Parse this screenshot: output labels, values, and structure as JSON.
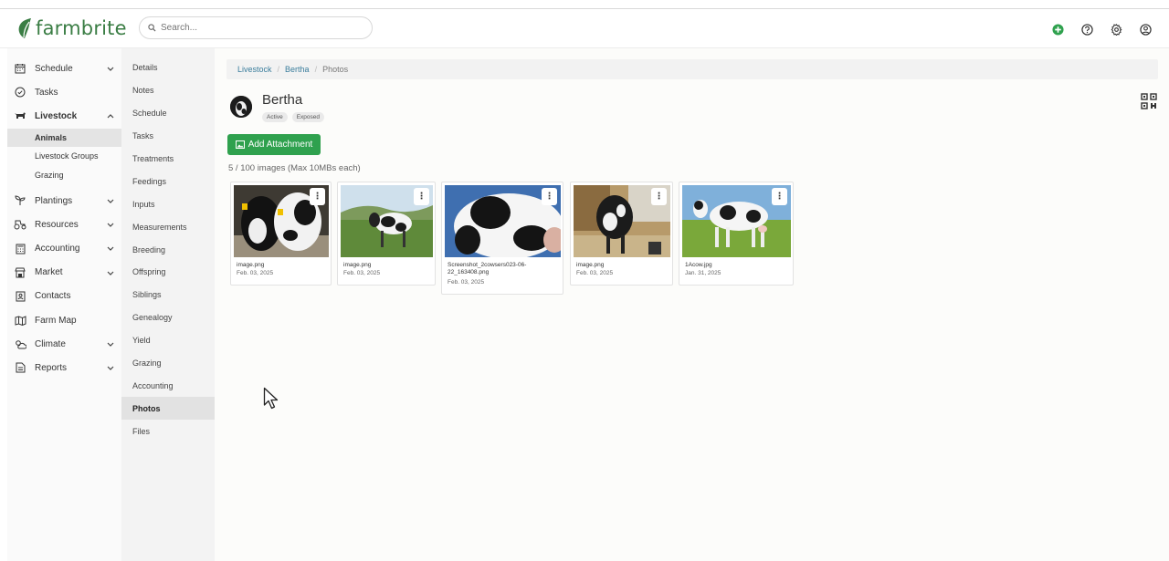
{
  "app": {
    "brand": "farmbrite"
  },
  "search": {
    "placeholder": "Search..."
  },
  "topbar_icons": [
    "plus-circle-icon",
    "help-icon",
    "gear-icon",
    "user-icon"
  ],
  "sidebar": {
    "items": [
      {
        "label": "Schedule",
        "icon": "calendar-icon",
        "chevron": "⌄"
      },
      {
        "label": "Tasks",
        "icon": "check-circle-icon"
      },
      {
        "label": "Livestock",
        "icon": "cow-icon",
        "chevron": "⌃",
        "expanded": true
      },
      {
        "label": "Plantings",
        "icon": "sprout-icon",
        "chevron": "⌄"
      },
      {
        "label": "Resources",
        "icon": "tractor-icon",
        "chevron": "⌄"
      },
      {
        "label": "Accounting",
        "icon": "calculator-icon",
        "chevron": "⌄"
      },
      {
        "label": "Market",
        "icon": "store-icon",
        "chevron": "⌄"
      },
      {
        "label": "Contacts",
        "icon": "contacts-icon"
      },
      {
        "label": "Farm Map",
        "icon": "map-icon"
      },
      {
        "label": "Climate",
        "icon": "cloud-sun-icon",
        "chevron": "⌄"
      },
      {
        "label": "Reports",
        "icon": "report-icon",
        "chevron": "⌄"
      }
    ],
    "livestock_sub": [
      "Animals",
      "Livestock Groups",
      "Grazing"
    ]
  },
  "subnav": [
    "Details",
    "Notes",
    "Schedule",
    "Tasks",
    "Treatments",
    "Feedings",
    "Inputs",
    "Measurements",
    "Breeding",
    "Offspring",
    "Siblings",
    "Genealogy",
    "Yield",
    "Grazing",
    "Accounting",
    "Photos",
    "Files"
  ],
  "breadcrumb": {
    "items": [
      "Livestock",
      "Bertha"
    ],
    "current": "Photos",
    "separator": "/"
  },
  "animal": {
    "name": "Bertha",
    "badges": [
      "Active",
      "Exposed"
    ]
  },
  "add_button": {
    "label": "Add Attachment"
  },
  "image_count": "5 / 100 images (Max 10MBs each)",
  "photos": [
    {
      "name": "image.png",
      "date": "Feb. 03, 2025",
      "menu": "⋮"
    },
    {
      "name": "image.png",
      "date": "Feb. 03, 2025",
      "menu": "⋮"
    },
    {
      "name": "Screenshot_2cowsers023-06-22_163408.png",
      "name_line1": "Screenshot_2cowsers023-06-",
      "name_line2": "22_163408.png",
      "date": "Feb. 03, 2025",
      "menu": "⋮"
    },
    {
      "name": "image.png",
      "date": "Feb. 03, 2025",
      "menu": "⋮"
    },
    {
      "name": "1Acow.jpg",
      "date": "Jan. 31, 2025",
      "menu": "⋮"
    }
  ],
  "colors": {
    "brand_green": "#3a7d44",
    "button_green": "#2fa14e",
    "link_blue": "#3a7d9c"
  }
}
